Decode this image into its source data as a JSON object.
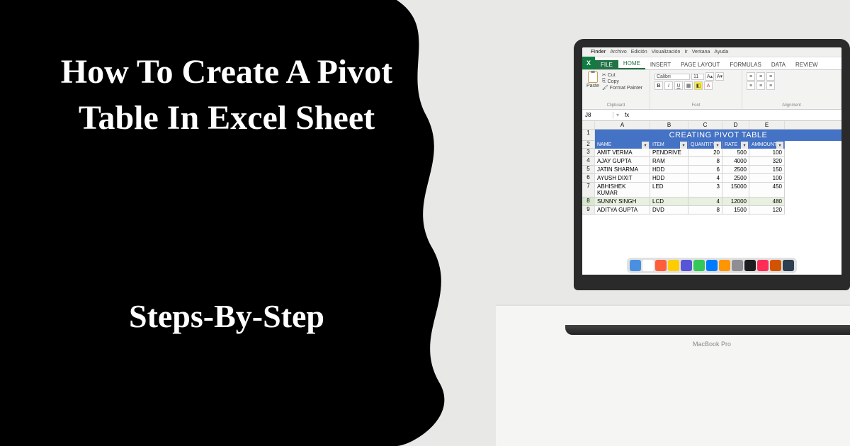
{
  "hero": {
    "title": "How To Create A Pivot Table In Excel Sheet",
    "subtitle": "Steps-By-Step"
  },
  "mac_menu": {
    "app": "Finder",
    "items": [
      "Archivo",
      "Edición",
      "Visualización",
      "Ir",
      "Ventana",
      "Ayuda"
    ]
  },
  "excel": {
    "tabs": {
      "file": "FILE",
      "home": "HOME",
      "insert": "INSERT",
      "page_layout": "PAGE LAYOUT",
      "formulas": "FORMULAS",
      "data": "DATA",
      "review": "REVIEW"
    },
    "clipboard": {
      "paste": "Paste",
      "cut": "Cut",
      "copy": "Copy",
      "format_painter": "Format Painter",
      "label": "Clipboard"
    },
    "font": {
      "name": "Calibri",
      "size": "11",
      "label": "Font"
    },
    "alignment": {
      "label": "Alignment"
    },
    "name_box": "J8",
    "fx": "fx"
  },
  "grid": {
    "cols": [
      "A",
      "B",
      "C",
      "D",
      "E"
    ],
    "title": "CREATING PIVOT TABLE",
    "headers": [
      "NAME",
      "ITEM",
      "QUANTITY",
      "RATE",
      "AMMOUNT"
    ],
    "rows": [
      {
        "rn": "3",
        "name": "AMIT VERMA",
        "item": "PENDRIVE",
        "qty": "20",
        "rate": "500",
        "amt": "100"
      },
      {
        "rn": "4",
        "name": "AJAY GUPTA",
        "item": "RAM",
        "qty": "8",
        "rate": "4000",
        "amt": "320"
      },
      {
        "rn": "5",
        "name": "JATIN SHARMA",
        "item": "HDD",
        "qty": "6",
        "rate": "2500",
        "amt": "150"
      },
      {
        "rn": "6",
        "name": "AYUSH DIXIT",
        "item": "HDD",
        "qty": "4",
        "rate": "2500",
        "amt": "100"
      },
      {
        "rn": "7",
        "name": "ABHISHEK KUMAR",
        "item": "LED",
        "qty": "3",
        "rate": "15000",
        "amt": "450"
      },
      {
        "rn": "8",
        "name": "SUNNY SINGH",
        "item": "LCD",
        "qty": "4",
        "rate": "12000",
        "amt": "480"
      },
      {
        "rn": "9",
        "name": "ADITYA GUPTA",
        "item": "DVD",
        "qty": "8",
        "rate": "1500",
        "amt": "120"
      }
    ]
  },
  "laptop_brand": "MacBook Pro",
  "dock_colors": [
    "#4a90e2",
    "#ffffff",
    "#ff5e3a",
    "#ffcc00",
    "#5856d6",
    "#34c759",
    "#007aff",
    "#ff9500",
    "#8e8e93",
    "#1d1d1f",
    "#ff2d55",
    "#d35400",
    "#2c3e50"
  ]
}
